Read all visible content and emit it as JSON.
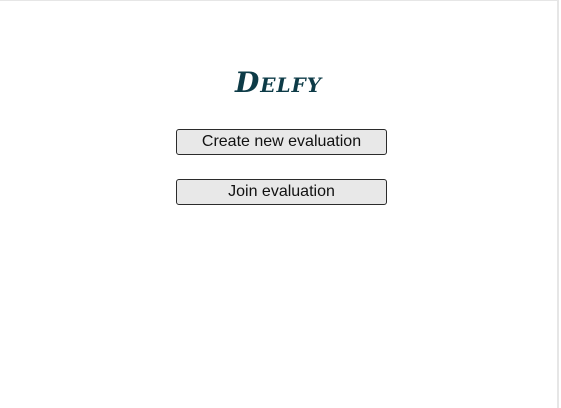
{
  "app": {
    "logo_text": "Delfy"
  },
  "actions": {
    "create_label": "Create new evaluation",
    "join_label": "Join evaluation"
  },
  "colors": {
    "logo": "#0d3b47",
    "button_bg": "#e8e8e8",
    "button_border": "#2b2b2b"
  }
}
